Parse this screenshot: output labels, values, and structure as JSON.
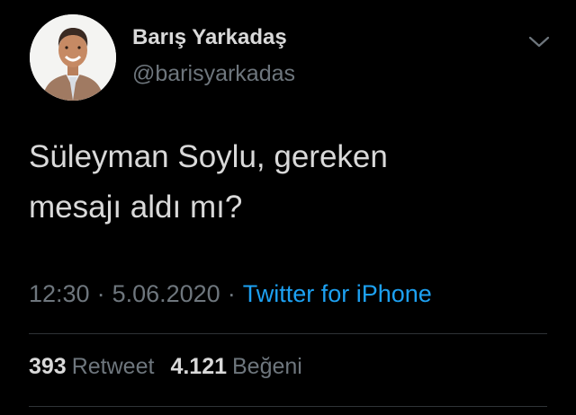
{
  "author": {
    "name": "Barış Yarkadaş",
    "handle": "@barisyarkadas",
    "avatar": "profile-photo"
  },
  "tweet": {
    "lines": [
      "Süleyman Soylu, gereken",
      "mesajı aldı mı?"
    ]
  },
  "meta": {
    "time": "12:30",
    "separator": "·",
    "date": "5.06.2020",
    "source": "Twitter for iPhone"
  },
  "stats": {
    "retweets_count": "393",
    "retweets_label": "Retweet",
    "likes_count": "4.121",
    "likes_label": "Beğeni"
  },
  "colors": {
    "background": "#000000",
    "text": "#d9d9d9",
    "muted": "#6e767d",
    "link": "#1da1f2",
    "divider": "#2f3336"
  },
  "icons": {
    "more": "chevron-down-icon"
  }
}
